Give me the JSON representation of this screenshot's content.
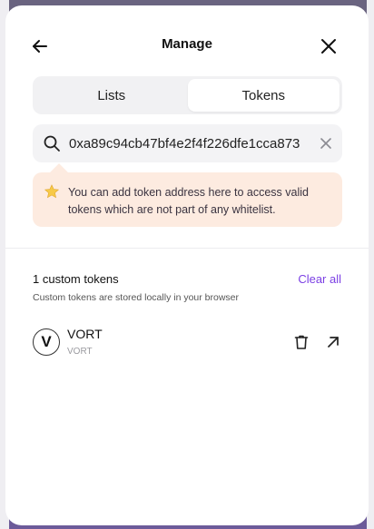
{
  "modal": {
    "title": "Manage",
    "back_icon": "arrow-left-icon",
    "close_icon": "close-icon"
  },
  "tabs": [
    {
      "label": "Lists",
      "active": false
    },
    {
      "label": "Tokens",
      "active": true
    }
  ],
  "search": {
    "value": "0xa89c94cb47bf4e2f4f226dfe1cca873",
    "icon": "search-icon",
    "clear_icon": "clear-icon"
  },
  "info": {
    "icon": "star-icon",
    "text": "You can add token address here to access valid tokens which are not part of any whitelist."
  },
  "custom_tokens": {
    "count_label": "1 custom tokens",
    "clear_all_label": "Clear all",
    "note": "Custom tokens are stored locally in your browser",
    "items": [
      {
        "symbol": "VORT",
        "name": "VORT",
        "logo_letter": "V"
      }
    ]
  },
  "colors": {
    "accent": "#7b3fe4",
    "info_bg": "#fdebe0",
    "tab_bg": "#f1f1f3"
  }
}
